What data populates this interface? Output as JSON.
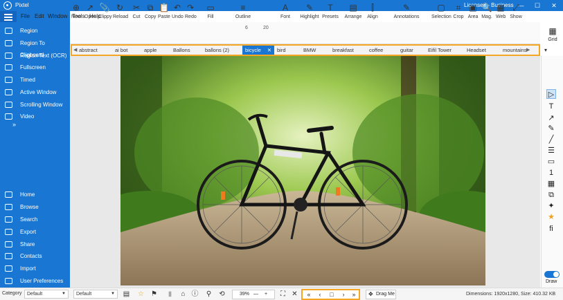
{
  "app": {
    "title": "Pixtel",
    "license": "Licensed - Business"
  },
  "window_controls": [
    "—",
    "☐",
    "✕"
  ],
  "menubar": [
    "File",
    "Edit",
    "Window",
    "Tools",
    "Help"
  ],
  "sidebar": {
    "top_items": [
      {
        "label": "Region",
        "icon": "capture-region-icon"
      },
      {
        "label": "Region To Clipboard",
        "icon": "clipboard-region-icon"
      },
      {
        "label": "Region Text (OCR)",
        "icon": "ocr-text-icon"
      },
      {
        "label": "Fullscreen",
        "icon": "fullscreen-icon"
      },
      {
        "label": "Timed",
        "icon": "timer-icon"
      },
      {
        "label": "Active Window",
        "icon": "window-icon"
      },
      {
        "label": "Scrolling Window",
        "icon": "scroll-window-icon"
      },
      {
        "label": "Video",
        "icon": "video-icon"
      }
    ],
    "more": "»",
    "bottom_items": [
      {
        "label": "Home",
        "icon": "home-icon"
      },
      {
        "label": "Browse",
        "icon": "folder-icon"
      },
      {
        "label": "Search",
        "icon": "search-icon"
      },
      {
        "label": "Export",
        "icon": "export-icon"
      },
      {
        "label": "Share",
        "icon": "share-icon"
      },
      {
        "label": "Contacts",
        "icon": "contacts-icon"
      },
      {
        "label": "Import",
        "icon": "import-icon"
      },
      {
        "label": "User Preferences",
        "icon": "user-icon"
      }
    ]
  },
  "ribbon": {
    "buttons": [
      {
        "label": "New",
        "glyph": "⊕"
      },
      {
        "label": "Open",
        "glyph": "↗"
      },
      {
        "label": "Clippy",
        "glyph": "📎"
      },
      {
        "label": "Reload",
        "glyph": "↻"
      },
      {
        "label": "Cut",
        "glyph": "✂"
      },
      {
        "label": "Copy",
        "glyph": "⧉"
      },
      {
        "label": "Paste",
        "glyph": "📋"
      },
      {
        "label": "Undo",
        "glyph": "↶"
      },
      {
        "label": "Redo",
        "glyph": "↷"
      },
      {
        "label": "Fill",
        "glyph": "▭"
      },
      {
        "label": "Outline",
        "glyph": "≡"
      },
      {
        "label": "Font",
        "glyph": "A"
      },
      {
        "label": "Highlight",
        "glyph": "✎"
      },
      {
        "label": "Presets",
        "glyph": "T"
      },
      {
        "label": "Arrange",
        "glyph": "▤"
      },
      {
        "label": "Align",
        "glyph": "⫿"
      },
      {
        "label": "Annotations",
        "glyph": "✎"
      },
      {
        "label": "Selection",
        "glyph": "▢"
      },
      {
        "label": "Crop",
        "glyph": "⌗"
      },
      {
        "label": "Area",
        "glyph": "▣"
      },
      {
        "label": "Mag.",
        "glyph": "🔍"
      },
      {
        "label": "Web",
        "glyph": "▦"
      },
      {
        "label": "Show",
        "glyph": "⤢"
      }
    ],
    "outline_width": "6",
    "font_size": "20",
    "grid_label": "Grid"
  },
  "tabs": {
    "items": [
      "abstract",
      "ai bot",
      "apple",
      "Ballons",
      "ballons (2)",
      "bicycle",
      "bird",
      "BMW",
      "breakfast",
      "coffee",
      "guitar",
      "Eifil Tower",
      "Headset",
      "mountains"
    ],
    "active": "bicycle",
    "close": "✕"
  },
  "right_toolbar": [
    "▷",
    "T",
    "↗",
    "✎",
    "╱",
    "☰",
    "▭",
    "1",
    "▦",
    "⧉",
    "✦",
    "★",
    "fi"
  ],
  "right_toolbar_names": [
    "pointer-icon",
    "text-icon",
    "arrow-icon",
    "pen-icon",
    "line-icon",
    "blur-icon",
    "shape-icon",
    "counter-icon",
    "image-icon",
    "stamp-icon",
    "effects-icon",
    "star-icon",
    "font-icon"
  ],
  "draw_label": "Draw",
  "status": {
    "category_label": "Category",
    "category_value": "Default",
    "preset_value": "Default",
    "zoom": "39%",
    "zoom_minus": "—",
    "zoom_plus": "+",
    "nav": [
      "«",
      "‹",
      "□",
      "›",
      "»"
    ],
    "drag_me": "Drag Me",
    "dimensions": "Dimensions: 1920x1280, Size: 410.32 KB"
  }
}
